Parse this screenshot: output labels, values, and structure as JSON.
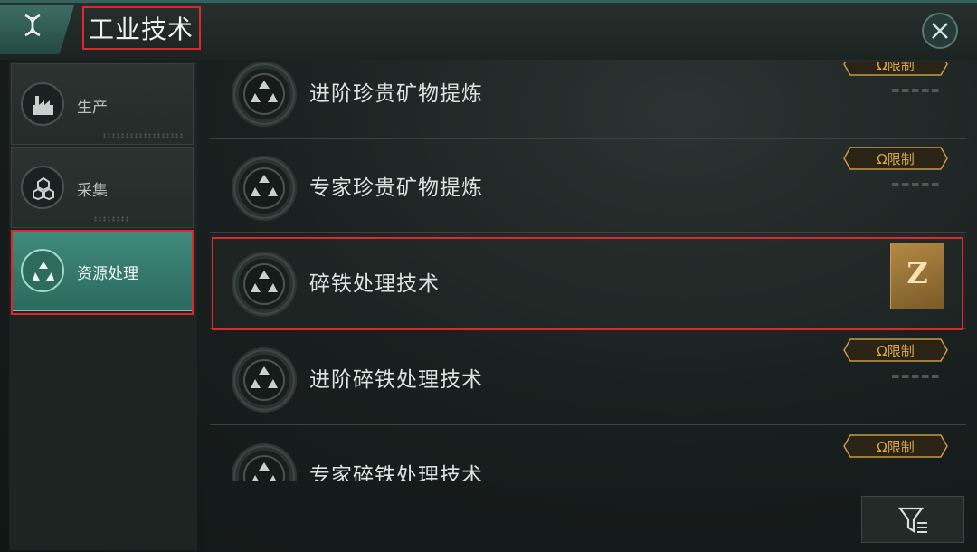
{
  "header": {
    "title": "工业技术",
    "home_icon": "dna-icon",
    "close_icon": "close-icon"
  },
  "sidebar": {
    "items": [
      {
        "label": "生产",
        "icon": "factory-icon",
        "active": false
      },
      {
        "label": "采集",
        "icon": "nodes-icon",
        "active": false
      },
      {
        "label": "资源处理",
        "icon": "recycle-icon",
        "active": true
      }
    ]
  },
  "techs": [
    {
      "name": "进阶珍贵矿物提炼",
      "badge": "Ω限制",
      "icon": "recycle-icon"
    },
    {
      "name": "专家珍贵矿物提炼",
      "badge": "Ω限制",
      "icon": "recycle-icon"
    },
    {
      "name": "碎铁处理技术",
      "badge": "",
      "unlock_label": "Z",
      "icon": "recycle-icon",
      "current": true
    },
    {
      "name": "进阶碎铁处理技术",
      "badge": "Ω限制",
      "icon": "recycle-icon"
    },
    {
      "name": "专家碎铁处理技术",
      "badge": "Ω限制",
      "icon": "recycle-icon"
    }
  ],
  "filter": {
    "icon": "filter-icon"
  },
  "colors": {
    "accent": "#3f8a7c",
    "badge_gold": "#d9a74a",
    "highlight_red": "#e0272b"
  }
}
